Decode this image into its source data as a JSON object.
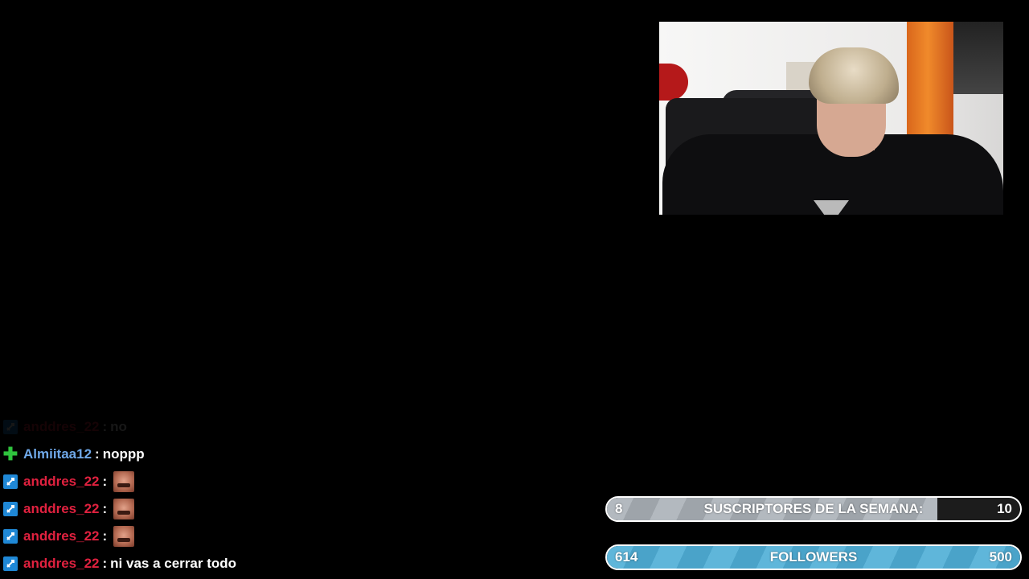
{
  "chat": {
    "messages": [
      {
        "user": "anddres_22",
        "user_color": "#e0213f",
        "sep": ":",
        "text": "no",
        "emote": false,
        "badge": "sword-icon",
        "faded": true
      },
      {
        "user": "Almiitaa12",
        "user_color": "#6fa8e8",
        "sep": ":",
        "text": "noppp",
        "emote": false,
        "badge": "plus-icon",
        "faded": false
      },
      {
        "user": "anddres_22",
        "user_color": "#e0213f",
        "sep": ":",
        "text": "",
        "emote": true,
        "badge": "sword-icon",
        "faded": false
      },
      {
        "user": "anddres_22",
        "user_color": "#e0213f",
        "sep": ":",
        "text": "",
        "emote": true,
        "badge": "sword-icon",
        "faded": false
      },
      {
        "user": "anddres_22",
        "user_color": "#e0213f",
        "sep": ":",
        "text": "",
        "emote": true,
        "badge": "sword-icon",
        "faded": false
      },
      {
        "user": "anddres_22",
        "user_color": "#e0213f",
        "sep": ":",
        "text": "ni vas a cerrar todo",
        "emote": false,
        "badge": "sword-icon",
        "faded": false
      }
    ]
  },
  "goals": {
    "subs": {
      "current": "8",
      "label": "SUSCRIPTORES DE LA SEMANA:",
      "target": "10",
      "progress": 0.8,
      "color": "#b3b9bf"
    },
    "followers": {
      "current": "614",
      "label": "FOLLOWERS",
      "target": "500",
      "progress": 1.0,
      "color": "#5fb6da"
    }
  }
}
